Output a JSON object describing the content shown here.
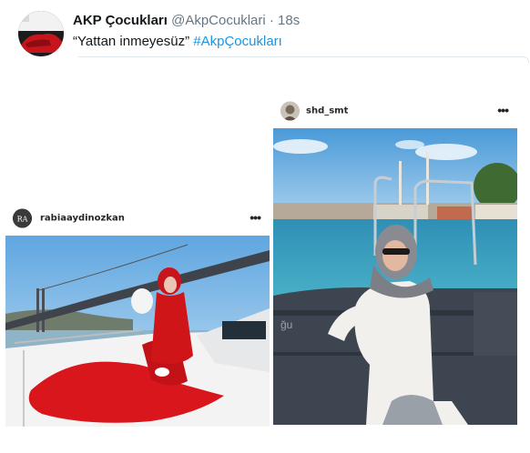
{
  "tweet": {
    "display_name": "AKP Çocukları",
    "handle": "@AkpCocuklari",
    "separator": "·",
    "time": "18s",
    "text": "“Yattan inmeyesüz”",
    "hashtag": "#AkpÇocukları"
  },
  "posts": [
    {
      "username": "rabiaaydinozkan",
      "avatar_monogram": "RA",
      "more_icon": "more-dots-icon"
    },
    {
      "username": "shd_smt",
      "more_icon": "more-dots-icon"
    }
  ],
  "photo2_overlay": "ğu",
  "colors": {
    "hashtag_blue": "#1b95e0",
    "dress_red": "#d8161b",
    "sea_blue": "#3aa6c8",
    "sky_blue": "#6fb3e5"
  }
}
